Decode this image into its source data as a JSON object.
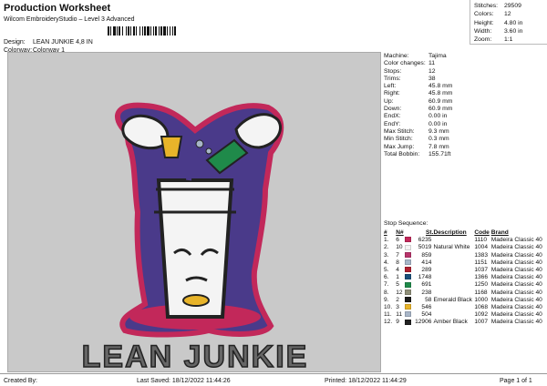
{
  "header": {
    "title": "Production Worksheet",
    "software": "Wilcom EmbroideryStudio – Level 3 Advanced",
    "design_label": "Design:",
    "design_value": "LEAN JUNKIE 4,8 IN",
    "colorway_label": "Colorway:",
    "colorway_value": "Colorway 1"
  },
  "summary": [
    {
      "label": "Stitches:",
      "value": "29509"
    },
    {
      "label": "Colors:",
      "value": "12"
    },
    {
      "label": "Height:",
      "value": "4.80 in"
    },
    {
      "label": "Width:",
      "value": "3.60 in"
    },
    {
      "label": "Zoom:",
      "value": "1:1"
    }
  ],
  "details": [
    {
      "label": "Machine:",
      "value": "Tajima"
    },
    {
      "label": "Color changes:",
      "value": "11"
    },
    {
      "label": "Stops:",
      "value": "12"
    },
    {
      "label": "Trims:",
      "value": "38"
    },
    {
      "label": "Left:",
      "value": "45.8 mm"
    },
    {
      "label": "Right:",
      "value": "45.8 mm"
    },
    {
      "label": "Up:",
      "value": "60.9 mm"
    },
    {
      "label": "Down:",
      "value": "60.9 mm"
    },
    {
      "label": "EndX:",
      "value": "0.00 in"
    },
    {
      "label": "EndY:",
      "value": "0.00 in"
    },
    {
      "label": "Max Stitch:",
      "value": "9.3 mm"
    },
    {
      "label": "Min Stitch:",
      "value": "0.3 mm"
    },
    {
      "label": "Max Jump:",
      "value": "7.8 mm"
    },
    {
      "label": "Total Bobbin:",
      "value": "155.71ft"
    }
  ],
  "stop_sequence": {
    "title": "Stop Sequence:",
    "columns": [
      "#",
      "N#",
      "",
      "St.",
      "Description",
      "Code",
      "Brand"
    ],
    "rows": [
      {
        "n": "1.",
        "nn": "6",
        "color": "#c2285a",
        "st": "6235",
        "desc": "",
        "code": "1110",
        "brand": "Madeira Classic 40"
      },
      {
        "n": "2.",
        "nn": "10",
        "color": "#f4f4f4",
        "st": "5019",
        "desc": "Natural White",
        "code": "1004",
        "brand": "Madeira Classic 40"
      },
      {
        "n": "3.",
        "nn": "7",
        "color": "#b8336a",
        "st": "859",
        "desc": "",
        "code": "1383",
        "brand": "Madeira Classic 40"
      },
      {
        "n": "4.",
        "nn": "8",
        "color": "#a7b7c9",
        "st": "414",
        "desc": "",
        "code": "1151",
        "brand": "Madeira Classic 40"
      },
      {
        "n": "5.",
        "nn": "4",
        "color": "#b02030",
        "st": "289",
        "desc": "",
        "code": "1037",
        "brand": "Madeira Classic 40"
      },
      {
        "n": "6.",
        "nn": "1",
        "color": "#1b4f7a",
        "st": "1748",
        "desc": "",
        "code": "1366",
        "brand": "Madeira Classic 40"
      },
      {
        "n": "7.",
        "nn": "5",
        "color": "#1f8a4a",
        "st": "691",
        "desc": "",
        "code": "1250",
        "brand": "Madeira Classic 40"
      },
      {
        "n": "8.",
        "nn": "12",
        "color": "#8f8f78",
        "st": "238",
        "desc": "",
        "code": "1168",
        "brand": "Madeira Classic 40"
      },
      {
        "n": "9.",
        "nn": "2",
        "color": "#1c1c1c",
        "st": "58",
        "desc": "Emerald Black",
        "code": "1000",
        "brand": "Madeira Classic 40"
      },
      {
        "n": "10.",
        "nn": "3",
        "color": "#e8b42a",
        "st": "546",
        "desc": "",
        "code": "1068",
        "brand": "Madeira Classic 40"
      },
      {
        "n": "11.",
        "nn": "11",
        "color": "#a8b6c8",
        "st": "504",
        "desc": "",
        "code": "1092",
        "brand": "Madeira Classic 40"
      },
      {
        "n": "12.",
        "nn": "9",
        "color": "#222222",
        "st": "12906",
        "desc": "Amber Black",
        "code": "1007",
        "brand": "Madeira Classic 40"
      }
    ]
  },
  "design_text": "LEAN JUNKIE",
  "colors": {
    "outline": "#c2285a",
    "cup": "#f4f4f4",
    "dark": "#222222",
    "green": "#1f8a4a",
    "yellow": "#e8b42a",
    "purple": "#4a3a8a",
    "lean_text": "#666666"
  },
  "footer": {
    "created_by": "Created By:",
    "last_saved": "Last Saved: 18/12/2022 11:44:26",
    "printed": "Printed: 18/12/2022 11:44:29",
    "page": "Page 1 of 1"
  }
}
